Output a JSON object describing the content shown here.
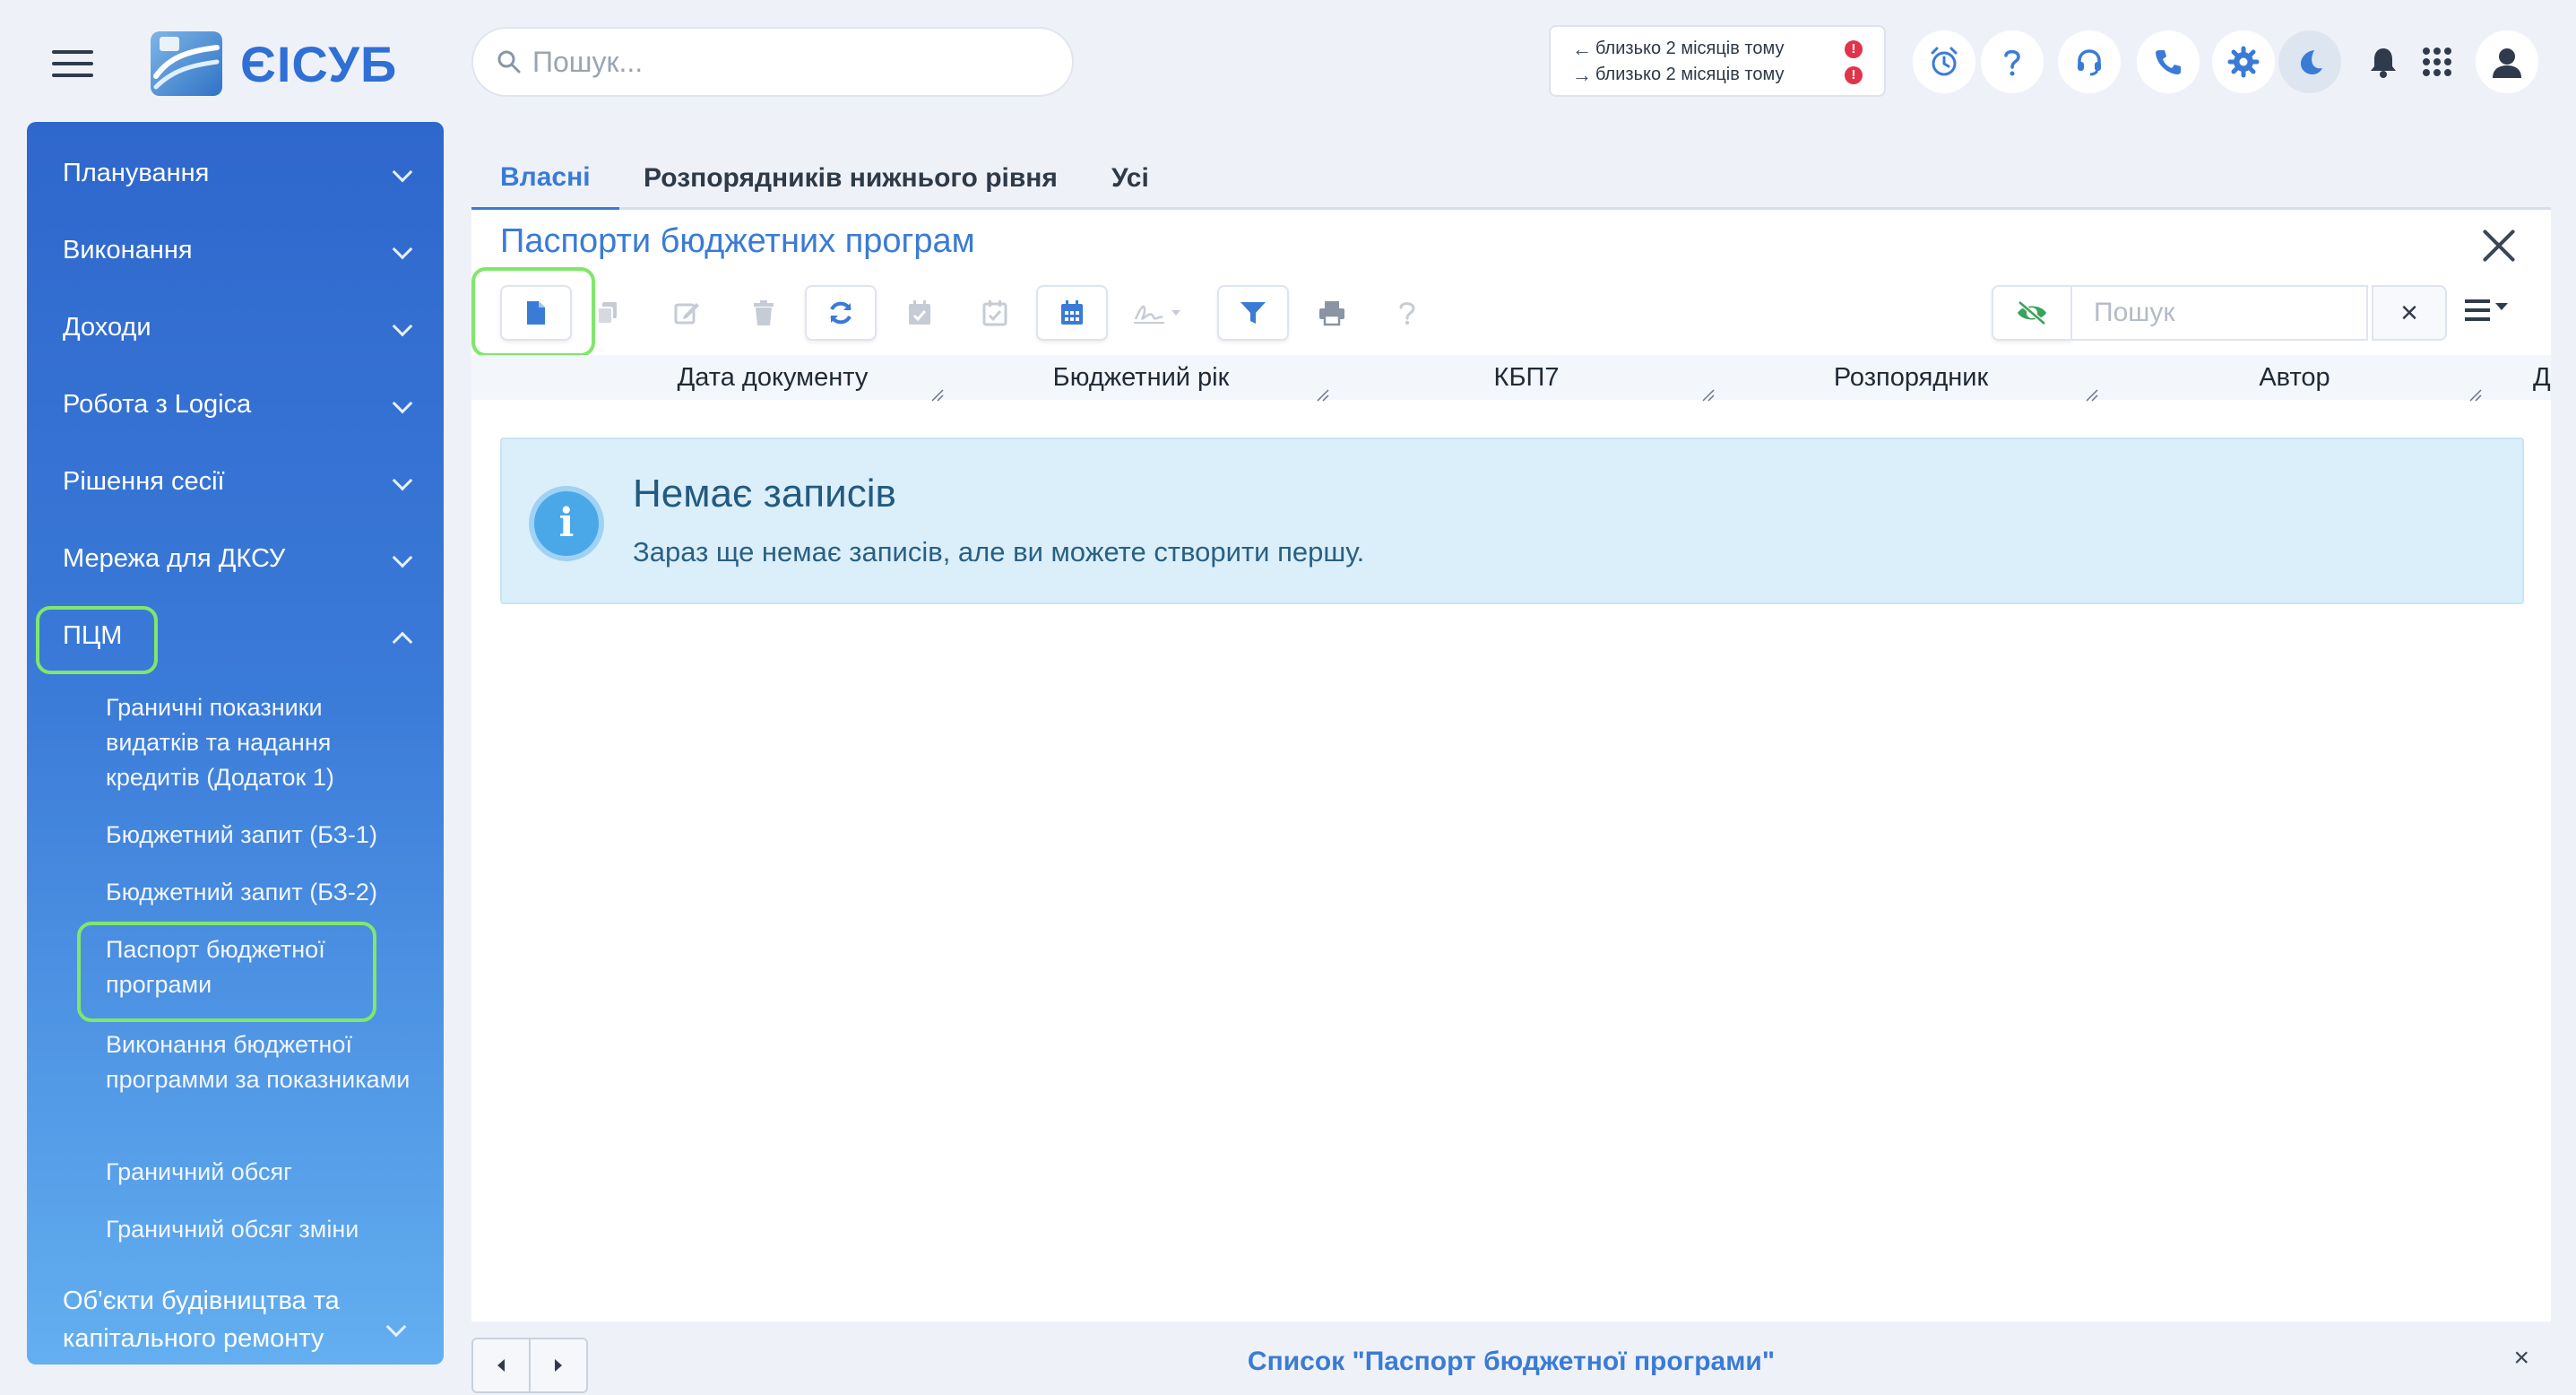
{
  "brand": {
    "name": "ЄІСУБ"
  },
  "top_search": {
    "placeholder": "Пошук..."
  },
  "sync": {
    "incoming": "близько 2 місяців тому",
    "outgoing": "близько 2 місяців тому"
  },
  "toolbar_icons": [
    "alarm-clock-icon",
    "question-icon",
    "headset-icon",
    "phone-icon",
    "gear-icon",
    "moon-icon",
    "bell-icon",
    "apps-grid-icon",
    "user-icon"
  ],
  "sidebar": {
    "items": [
      {
        "label": "Планування"
      },
      {
        "label": "Виконання"
      },
      {
        "label": "Доходи"
      },
      {
        "label": "Робота з Logica"
      },
      {
        "label": "Рішення сесії"
      },
      {
        "label": "Мережа для ДКСУ"
      },
      {
        "label": "ПЦМ"
      },
      {
        "label": "Об'єкти будівництва та капітального ремонту"
      }
    ],
    "pcm_children": [
      {
        "label": "Граничні показники видатків та надання кредитів (Додаток 1)"
      },
      {
        "label": "Бюджетний запит (БЗ-1)"
      },
      {
        "label": "Бюджетний запит (БЗ-2)"
      },
      {
        "label": "Паспорт бюджетної програми"
      },
      {
        "label": "Виконання бюджетної программи за показниками"
      },
      {
        "label": "Граничний обсяг"
      },
      {
        "label": "Граничний обсяг зміни"
      }
    ]
  },
  "tabs": [
    {
      "label": "Власні"
    },
    {
      "label": "Розпорядників нижнього рівня"
    },
    {
      "label": "Усі"
    }
  ],
  "panel": {
    "title": "Паспорти бюджетних програм",
    "search_placeholder": "Пошук",
    "clear_label": "×"
  },
  "columns": [
    "Дата документу",
    "Бюджетний рік",
    "КБП7",
    "Розпорядник",
    "Автор",
    "Д"
  ],
  "empty_state": {
    "title": "Немає записів",
    "message": "Зараз ще немає записів, але ви можете створити першу."
  },
  "status": {
    "text": "Список \"Паспорт бюджетної програми\"",
    "close": "×"
  },
  "colors": {
    "accent": "#3a7bd6",
    "highlight": "#7fe76a",
    "info_bg": "#dbeffa"
  }
}
